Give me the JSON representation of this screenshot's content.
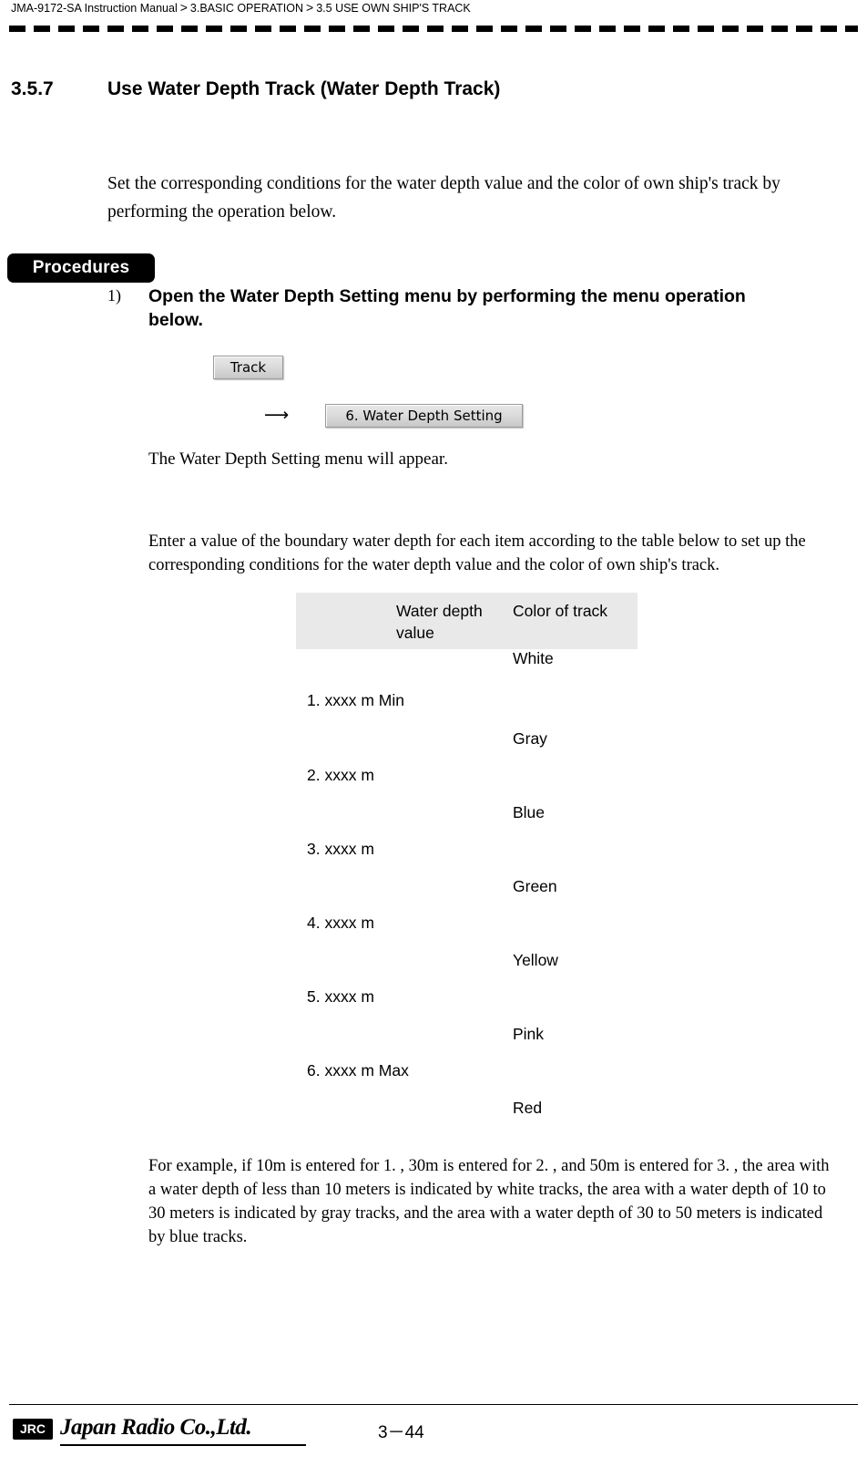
{
  "header": {
    "manual": "JMA-9172-SA Instruction Manual",
    "sep1": ">",
    "chapter": "3.BASIC OPERATION",
    "sep2": ">",
    "section": "3.5  USE OWN SHIP'S TRACK"
  },
  "section": {
    "number": "3.5.7",
    "title": "Use Water Depth Track (Water Depth Track)"
  },
  "intro": "Set the corresponding conditions for the water depth value and the color of own ship's track by performing the operation below.",
  "procedures_label": "Procedures",
  "step1": {
    "number": "1)",
    "text": "Open the Water Depth Setting menu by performing the menu operation below."
  },
  "buttons": {
    "track": "Track",
    "arrow": "⟶",
    "water_depth_setting": "6. Water Depth Setting"
  },
  "appear_text": "The Water Depth Setting menu will appear.",
  "enter_para": "Enter a value of the boundary water depth for each item according to the table below to set up the corresponding conditions for the water depth value and the color of own ship's track.",
  "table": {
    "headers": {
      "blank": "",
      "depth": "Water  depth value",
      "color": "Color of track"
    },
    "colors": [
      "White",
      "Gray",
      "Blue",
      "Green",
      "Yellow",
      "Pink",
      "Red"
    ],
    "items": [
      "1. xxxx m  Min",
      "2. xxxx m",
      "3. xxxx m",
      "4. xxxx m",
      "5. xxxx m",
      "6. xxxx m  Max"
    ]
  },
  "example": "For example, if 10m is entered for  1. , 30m is entered for  2. , and 50m is entered for 3. , the area with a water depth of less than 10 meters is indicated by white tracks, the area with a water depth of 10 to 30 meters is indicated by gray tracks, and the area with a water depth of 30 to 50 meters is indicated by blue tracks.",
  "footer": {
    "logo": "JRC",
    "company": "Japan Radio Co.,Ltd.",
    "page": "3－44"
  }
}
